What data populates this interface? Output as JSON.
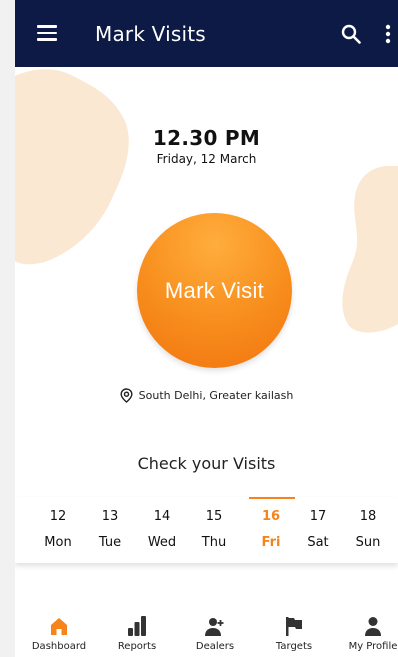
{
  "appbar": {
    "title": "Mark Visits",
    "bg_color": "#0c1a45",
    "menu_icon": "hamburger-menu-icon",
    "search_icon": "search-icon",
    "more_icon": "more-vertical-icon"
  },
  "clock": {
    "time": "12.30 PM",
    "date": "Friday, 12 March"
  },
  "mark_visit": {
    "label": "Mark Visit",
    "color": "#f7841a"
  },
  "location": {
    "icon": "location-pin-icon",
    "text": "South Delhi, Greater kailash"
  },
  "visits": {
    "title": "Check your Visits",
    "accent_color": "#f7841a",
    "days": [
      {
        "num": "12",
        "name": "Mon",
        "active": false
      },
      {
        "num": "13",
        "name": "Tue",
        "active": false
      },
      {
        "num": "14",
        "name": "Wed",
        "active": false
      },
      {
        "num": "15",
        "name": "Thu",
        "active": false
      },
      {
        "num": "16",
        "name": "Fri",
        "active": true
      },
      {
        "num": "17",
        "name": "Sat",
        "active": false
      },
      {
        "num": "18",
        "name": "Sun",
        "active": false
      }
    ]
  },
  "bottom_nav": {
    "items": [
      {
        "label": "Dashboard",
        "icon": "home-icon",
        "active": true
      },
      {
        "label": "Reports",
        "icon": "bar-chart-icon",
        "active": false
      },
      {
        "label": "Dealers",
        "icon": "add-user-icon",
        "active": false
      },
      {
        "label": "Targets",
        "icon": "flag-icon",
        "active": false
      },
      {
        "label": "My Profile",
        "icon": "person-icon",
        "active": false
      }
    ]
  }
}
